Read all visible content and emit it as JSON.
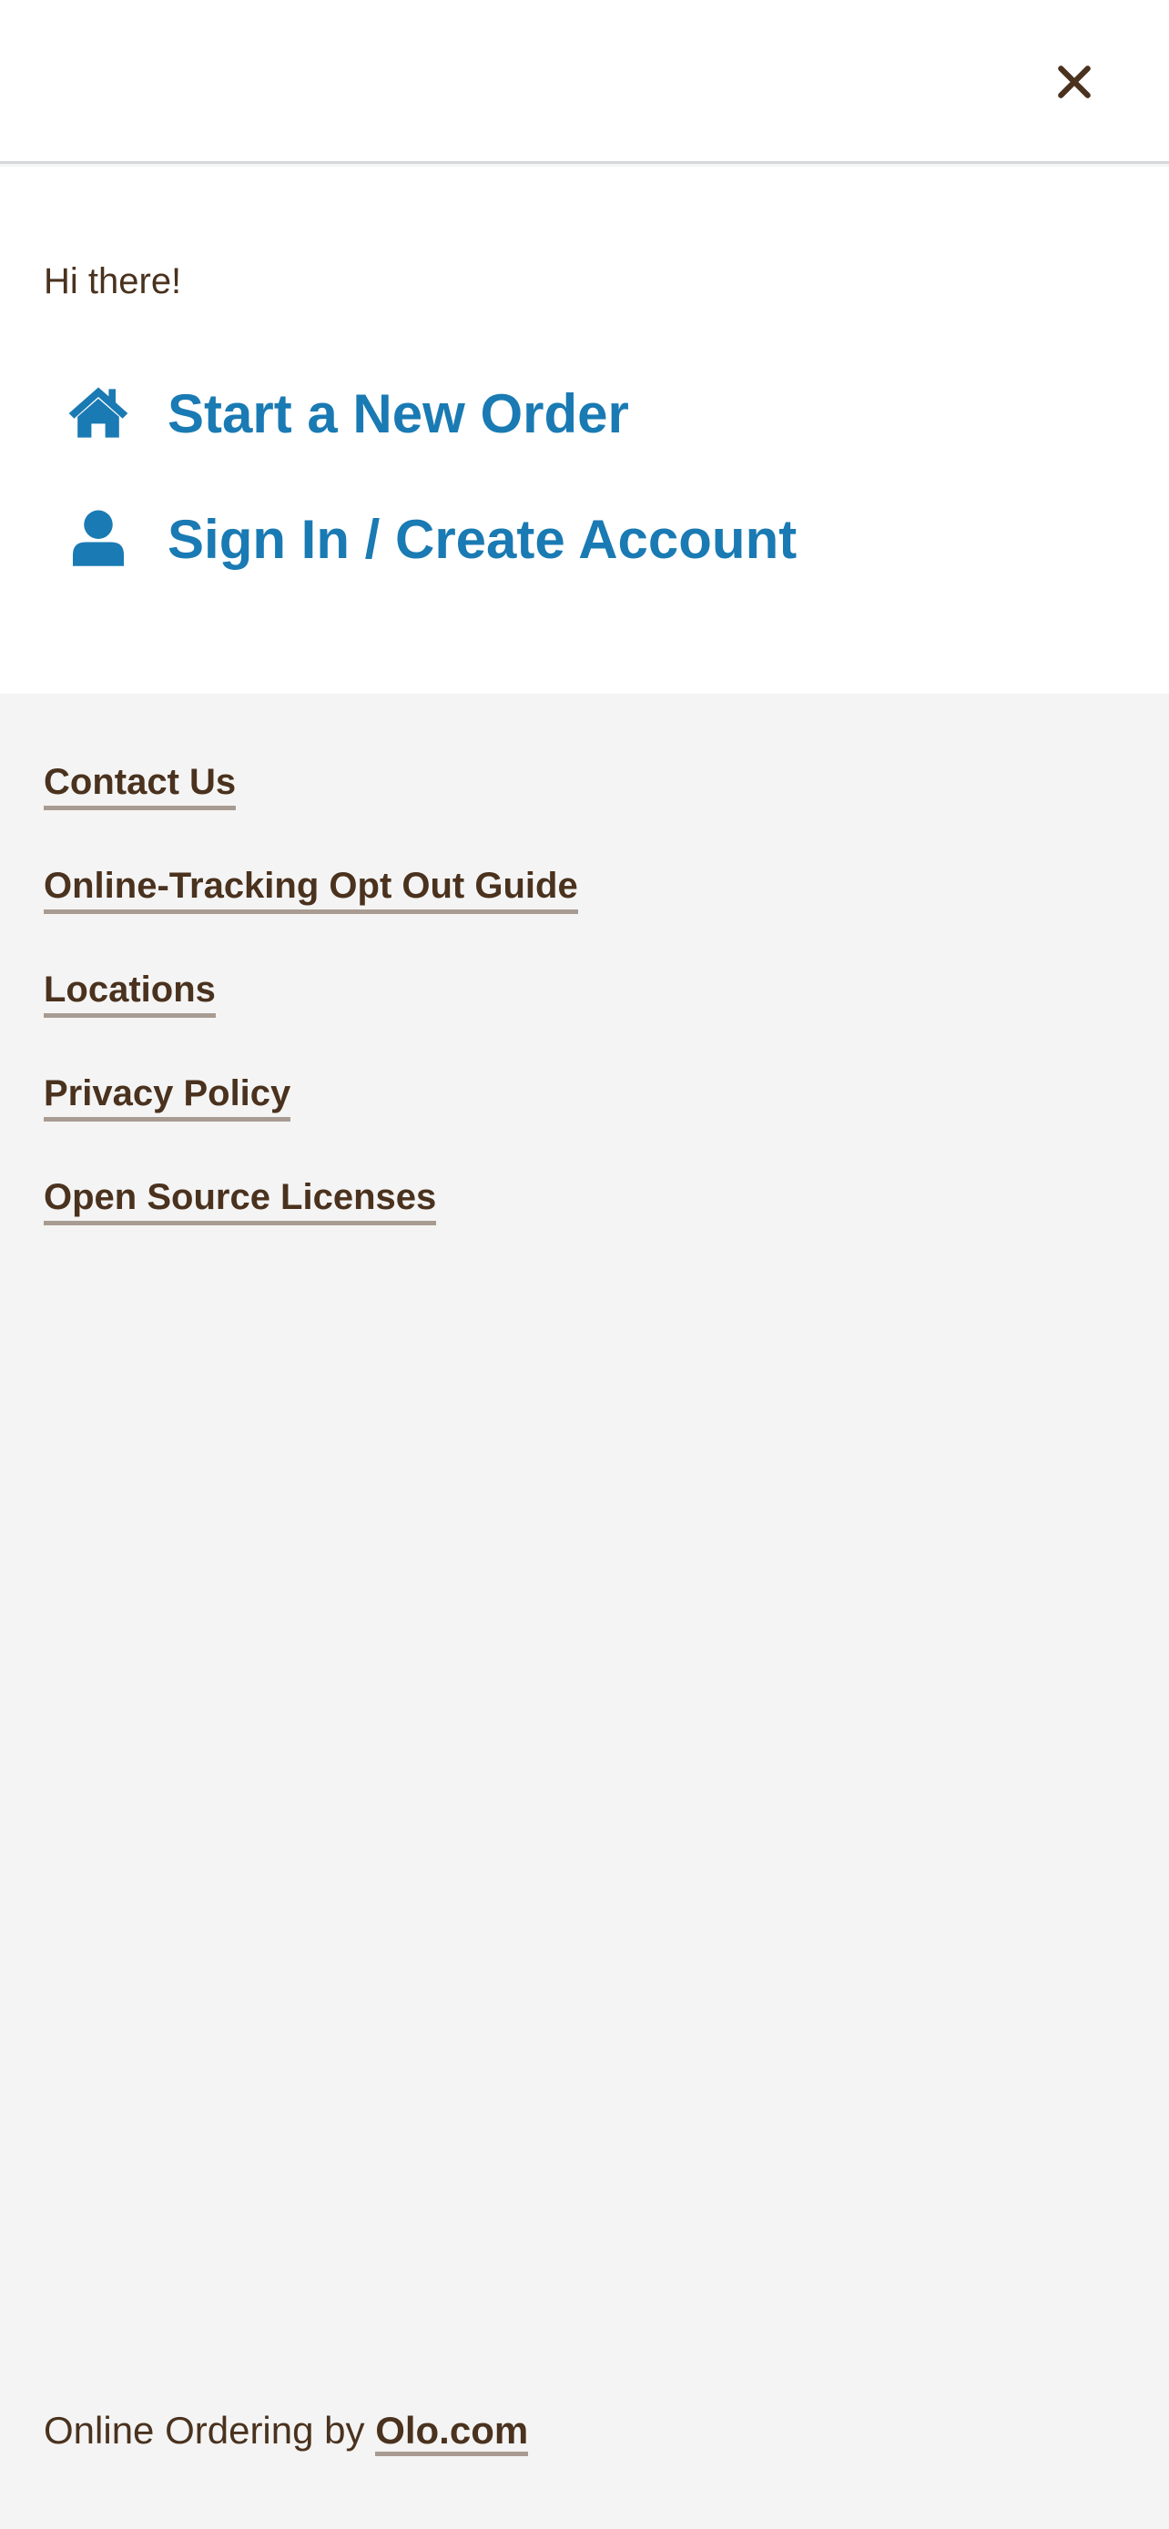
{
  "header": {
    "close_icon": "close-icon"
  },
  "menu": {
    "greeting": "Hi there!",
    "items": [
      {
        "label": "Start a New Order",
        "icon": "home-icon"
      },
      {
        "label": "Sign In / Create Account",
        "icon": "user-icon"
      }
    ],
    "accent_color": "#1a7ab3"
  },
  "footer": {
    "links": [
      {
        "label": "Contact Us"
      },
      {
        "label": "Online-Tracking Opt Out Guide"
      },
      {
        "label": "Locations"
      },
      {
        "label": "Privacy Policy"
      },
      {
        "label": "Open Source Licenses"
      }
    ],
    "powered_by_prefix": "Online Ordering by",
    "powered_by_link": "Olo.com"
  },
  "colors": {
    "text": "#4a321e",
    "panel_background": "#ffffff",
    "page_background": "#f4f4f4"
  }
}
